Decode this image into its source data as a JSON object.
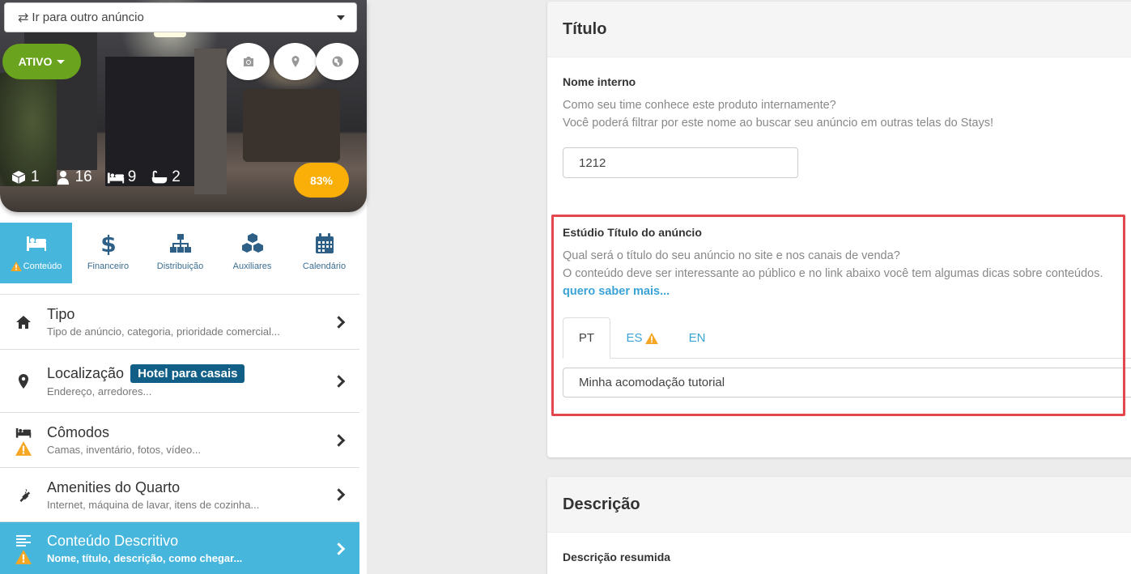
{
  "header": {
    "goto_label": "Ir para outro anúncio",
    "status_label": "ATIVO",
    "camera_icon": "camera-icon",
    "pin_icon": "map-pin-icon",
    "globe_icon": "globe-icon"
  },
  "stats": {
    "units": "1",
    "guests": "16",
    "beds": "9",
    "baths": "2",
    "completion": "83%"
  },
  "section_tabs": [
    {
      "label": "Conteúdo",
      "icon": "bed-icon",
      "active": true,
      "warning": true
    },
    {
      "label": "Financeiro",
      "icon": "dollar-icon",
      "active": false
    },
    {
      "label": "Distribuição",
      "icon": "sitemap-icon",
      "active": false
    },
    {
      "label": "Auxiliares",
      "icon": "cubes-icon",
      "active": false
    },
    {
      "label": "Calendário",
      "icon": "calendar-icon",
      "active": false
    }
  ],
  "menu": {
    "tipo": {
      "title": "Tipo",
      "subtitle": "Tipo de anúncio, categoria, prioridade comercial..."
    },
    "localizacao": {
      "title": "Localização",
      "badge": "Hotel para casais",
      "subtitle": "Endereço, arredores..."
    },
    "comodos": {
      "title": "Cômodos",
      "subtitle": "Camas, inventário, fotos, vídeo..."
    },
    "amenities": {
      "title": "Amenities do Quarto",
      "subtitle": "Internet, máquina de lavar, itens de cozinha..."
    },
    "conteudo": {
      "title": "Conteúdo Descritivo",
      "subtitle": "Nome, título, descrição, como chegar..."
    }
  },
  "titulo_card": {
    "heading": "Título",
    "nome_interno_label": "Nome interno",
    "nome_interno_help_1": "Como seu time conhece este produto internamente?",
    "nome_interno_help_2": "Você poderá filtrar por este nome ao buscar seu anúncio em outras telas do Stays!",
    "nome_interno_value": "1212",
    "titulo_anuncio_label": "Estúdio Título do anúncio",
    "titulo_anuncio_help_1": "Qual será o título do seu anúncio no site e nos canais de venda?",
    "titulo_anuncio_help_2": "O conteúdo deve ser interessante ao público e no link abaixo você tem algumas dicas sobre conteúdos.",
    "learn_more": "quero saber mais...",
    "lang_tabs": [
      "PT",
      "ES",
      "EN"
    ],
    "titulo_value": "Minha acomodação tutorial"
  },
  "descricao_card": {
    "heading": "Descrição",
    "resumida_label": "Descrição resumida"
  },
  "colors": {
    "accent": "#47b6dc",
    "status_green": "#6aa31e",
    "completion_orange": "#f9ae08",
    "badge_blue": "#115f86",
    "highlight_red": "#e3464c",
    "warning_yellow": "#f5a623"
  }
}
